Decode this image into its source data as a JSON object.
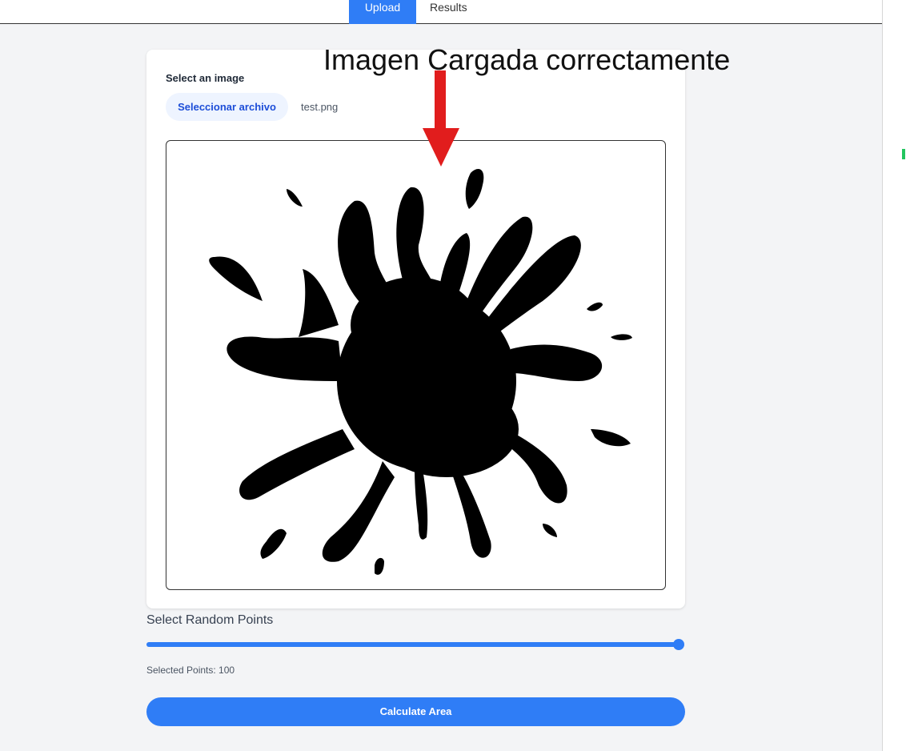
{
  "tabs": [
    {
      "label": "Upload",
      "active": true
    },
    {
      "label": "Results",
      "active": false
    }
  ],
  "upload": {
    "label": "Select an image",
    "file_button": "Seleccionar archivo",
    "file_name": "test.png"
  },
  "annotation": "Imagen Cargada correctamente",
  "points": {
    "title": "Select Random Points",
    "value": 100,
    "value_text": "Selected Points: 100",
    "slider_fraction": 1.0
  },
  "calculate_button": "Calculate Area",
  "colors": {
    "accent": "#2f7df6",
    "annotation_arrow": "#e11d1d",
    "splat": "#000000"
  },
  "icons": {
    "annotation_arrow": "red-down-arrow-icon",
    "preview": "ink-splat-image"
  }
}
